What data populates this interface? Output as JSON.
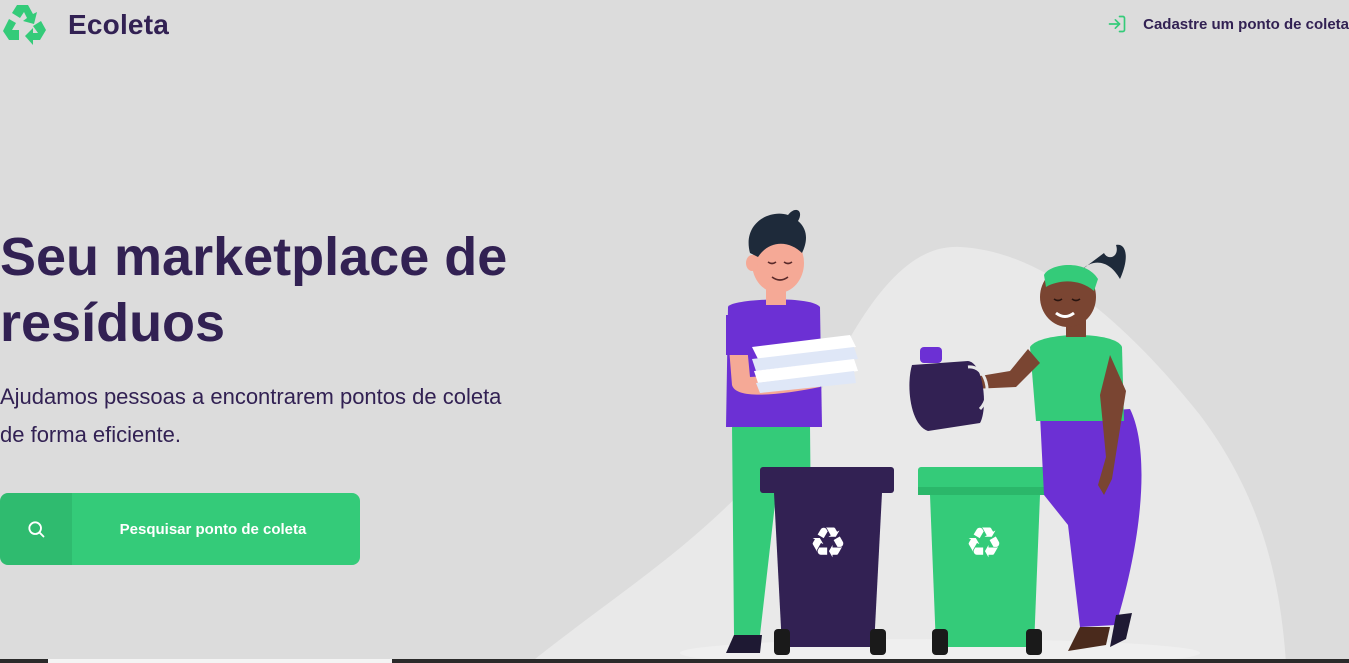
{
  "header": {
    "app_name": "Ecoleta",
    "register_link": "Cadastre um ponto de coleta"
  },
  "hero": {
    "title_line1": "Seu marketplace de",
    "title_line2": "resíduos",
    "description_line1": "Ajudamos pessoas a encontrarem pontos de coleta",
    "description_line2": "de forma eficiente.",
    "search_button": "Pesquisar ponto de coleta"
  },
  "colors": {
    "primary": "#34cb79",
    "title": "#322153",
    "background": "#dcdcdc",
    "accent_purple": "#6c30d4"
  },
  "icons": {
    "logo": "recycle-icon",
    "register": "log-in-icon",
    "search": "search-icon"
  }
}
